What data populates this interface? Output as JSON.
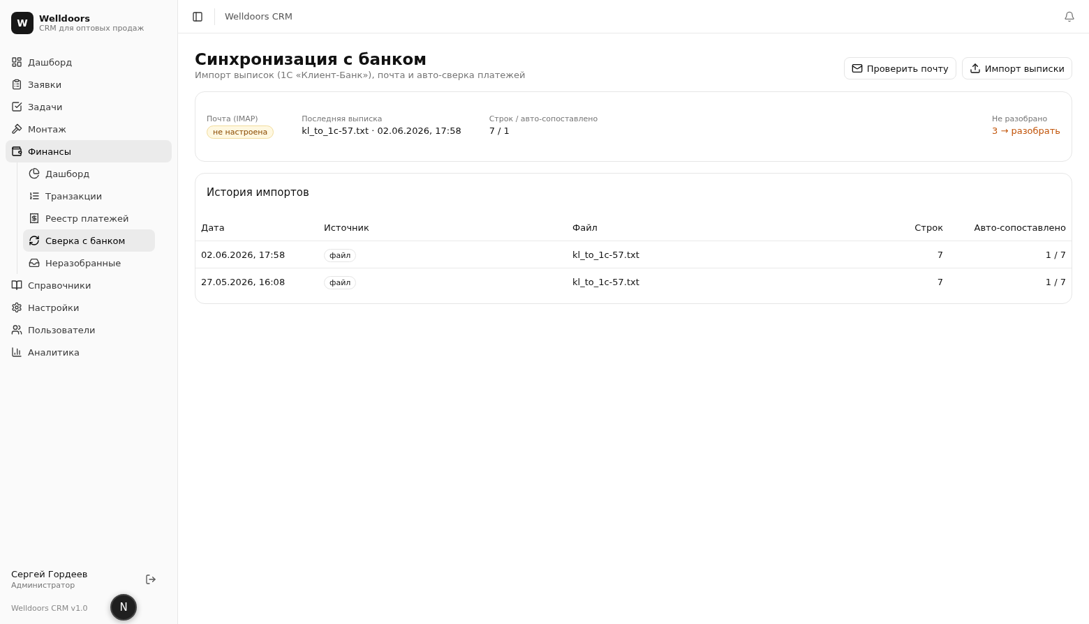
{
  "brand": {
    "logo": "W",
    "name": "Welldoors",
    "tagline": "CRM для оптовых продаж"
  },
  "nav": [
    {
      "label": "Дашборд",
      "selected": false
    },
    {
      "label": "Заявки",
      "selected": false
    },
    {
      "label": "Задачи",
      "selected": false
    },
    {
      "label": "Монтаж",
      "selected": false
    },
    {
      "label": "Финансы",
      "selected": true,
      "children": [
        {
          "label": "Дашборд",
          "selected": false
        },
        {
          "label": "Транзакции",
          "selected": false
        },
        {
          "label": "Реестр платежей",
          "selected": false
        },
        {
          "label": "Сверка с банком",
          "selected": true
        },
        {
          "label": "Неразобранные",
          "selected": false
        }
      ]
    },
    {
      "label": "Справочники",
      "selected": false
    },
    {
      "label": "Настройки",
      "selected": false
    },
    {
      "label": "Пользователи",
      "selected": false
    },
    {
      "label": "Аналитика",
      "selected": false
    }
  ],
  "user": {
    "name": "Сергей Гордеев",
    "role": "Администратор"
  },
  "version": "Welldoors CRM v1.0",
  "dev_badge": "N",
  "header": {
    "breadcrumb": "Welldoors CRM"
  },
  "page": {
    "title": "Синхронизация с банком",
    "subtitle": "Импорт выписок (1С «Клиент-Банк»), почта и авто-сверка платежей",
    "buttons": [
      "Проверить почту",
      "Импорт выписки"
    ]
  },
  "stats": [
    {
      "label": "Почта (IMAP)",
      "value": "не настроена",
      "kind": "badge"
    },
    {
      "label": "Последняя выписка",
      "value": "kl_to_1c-57.txt · 02.06.2026, 17:58",
      "kind": "text"
    },
    {
      "label": "Строк / авто-сопоставлено",
      "value": "7 / 1",
      "kind": "text"
    },
    {
      "label": "Не разобрано",
      "value": "3 → разобрать",
      "kind": "link"
    }
  ],
  "history": {
    "title": "История импортов",
    "columns": [
      "Дата",
      "Источник",
      "Файл",
      "Строк",
      "Авто-сопоставлено"
    ],
    "rows": [
      {
        "date": "02.06.2026, 17:58",
        "source": "файл",
        "file": "kl_to_1c-57.txt",
        "lines": "7",
        "matched": "1 / 7"
      },
      {
        "date": "27.05.2026, 16:08",
        "source": "файл",
        "file": "kl_to_1c-57.txt",
        "lines": "7",
        "matched": "1 / 7"
      }
    ]
  }
}
